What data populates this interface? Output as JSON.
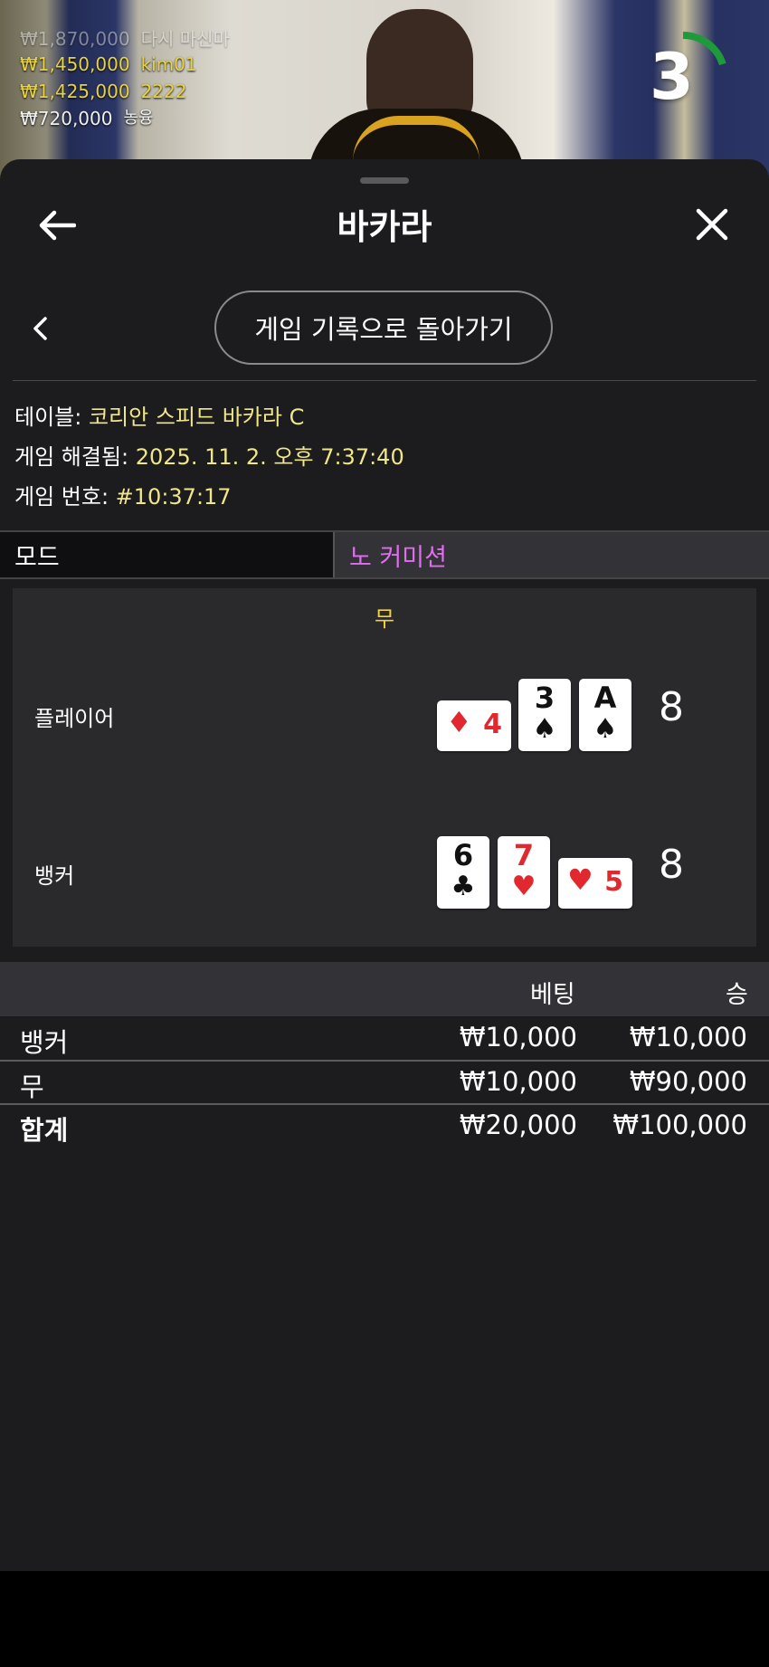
{
  "background": {
    "leaderboard": [
      {
        "amount": "₩1,870,000",
        "name": "다시 마신마",
        "faded": true
      },
      {
        "amount": "₩1,450,000",
        "name": "kim01"
      },
      {
        "amount": "₩1,425,000",
        "name": "2222"
      },
      {
        "amount": "₩720,000",
        "name": "농융",
        "dim": true
      }
    ],
    "timer": {
      "value": "3",
      "remaining_fraction": 0.2,
      "color": "#1f9a3a"
    }
  },
  "header": {
    "back_icon": "arrow-left-icon",
    "title": "바카라",
    "close_icon": "close-icon"
  },
  "nav": {
    "back_chevron": "chevron-left-icon",
    "history_button": "게임 기록으로 돌아가기"
  },
  "info": {
    "table_label": "테이블: ",
    "table_value": "코리안 스피드 바카라 C",
    "resolved_label": "게임 해결됨: ",
    "resolved_value": "2025. 11. 2. 오후 7:37:40",
    "number_label": "게임 번호: ",
    "number_value": "#10:37:17"
  },
  "mode": {
    "label": "모드",
    "value": "노 커미션"
  },
  "result": {
    "outcome": "무",
    "player": {
      "label": "플레이어",
      "score": "8",
      "cards": [
        {
          "rank": "4",
          "suit": "♦",
          "color": "red",
          "rotated": true
        },
        {
          "rank": "3",
          "suit": "♠",
          "color": "black"
        },
        {
          "rank": "A",
          "suit": "♠",
          "color": "black"
        }
      ]
    },
    "banker": {
      "label": "뱅커",
      "score": "8",
      "cards": [
        {
          "rank": "6",
          "suit": "♣",
          "color": "black"
        },
        {
          "rank": "7",
          "suit": "♥",
          "color": "red"
        },
        {
          "rank": "5",
          "suit": "♥",
          "color": "red",
          "rotated": true
        }
      ]
    }
  },
  "bets": {
    "headers": {
      "bet": "베팅",
      "win": "승"
    },
    "rows": [
      {
        "name": "뱅커",
        "bet": "₩10,000",
        "win": "₩10,000"
      },
      {
        "name": "무",
        "bet": "₩10,000",
        "win": "₩90,000"
      },
      {
        "name": "합계",
        "bet": "₩20,000",
        "win": "₩100,000",
        "bold": true
      }
    ]
  },
  "colors": {
    "panel": "#1c1b1d",
    "accent_yellow": "#f1d23a",
    "mode_value": "#e06df0",
    "red_suit": "#e0282e"
  }
}
